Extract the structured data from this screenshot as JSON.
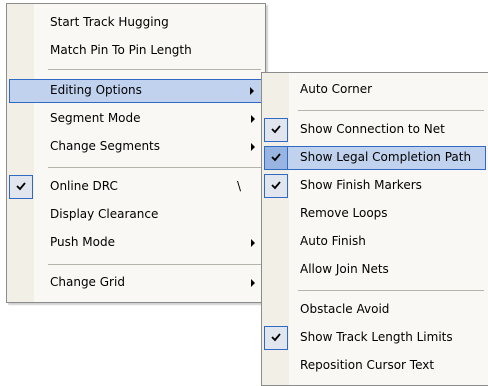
{
  "main_menu": {
    "start_track_hugging": "Start Track Hugging",
    "match_pin_to_pin_length": "Match Pin To Pin Length",
    "editing_options": "Editing Options",
    "segment_mode": "Segment Mode",
    "change_segments": "Change Segments",
    "online_drc": "Online DRC",
    "online_drc_shortcut": "\\",
    "display_clearance": "Display Clearance",
    "push_mode": "Push Mode",
    "change_grid": "Change Grid"
  },
  "editing_options_submenu": {
    "auto_corner": "Auto Corner",
    "show_connection_to_net": "Show Connection to Net",
    "show_legal_completion_path": "Show Legal Completion Path",
    "show_finish_markers": "Show Finish Markers",
    "remove_loops": "Remove Loops",
    "auto_finish": "Auto Finish",
    "allow_join_nets": "Allow Join Nets",
    "obstacle_avoid": "Obstacle Avoid",
    "show_track_length_limits": "Show Track Length Limits",
    "reposition_cursor_text": "Reposition Cursor Text"
  },
  "checked_items": [
    "Online DRC",
    "Show Connection to Net",
    "Show Legal Completion Path",
    "Show Finish Markers",
    "Show Track Length Limits"
  ],
  "colors": {
    "highlight": "#c1d2ee",
    "highlight_border": "#316ac5",
    "menu_background": "#f9f8f4"
  }
}
